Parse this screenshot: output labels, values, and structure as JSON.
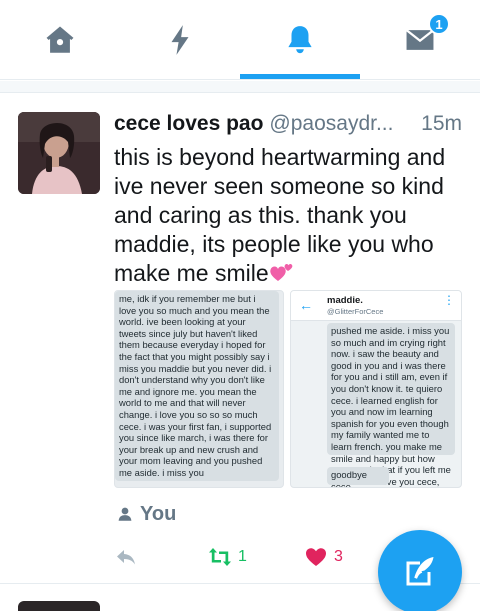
{
  "nav": {
    "tabs": [
      {
        "name": "home",
        "icon": "home-icon"
      },
      {
        "name": "moments",
        "icon": "lightning-icon"
      },
      {
        "name": "notifications",
        "icon": "bell-icon",
        "active": true
      },
      {
        "name": "messages",
        "icon": "envelope-icon"
      }
    ],
    "messages_badge": "1",
    "accent_color": "#1da1f2",
    "inactive_icon_color": "#657786"
  },
  "tweet": {
    "display_name": "cece loves pao",
    "handle": "@paosaydr...",
    "timestamp": "15m",
    "text": "this is beyond heartwarming and ive never seen someone so kind and caring as this. thank you maddie, its people like you who make me smile",
    "emoji": "two-hearts-icon",
    "media": {
      "left_text": "me, idk if you remember me but i love you so much and you mean the world. ive been looking at your tweets since july but haven't liked them because everyday i hoped for the fact that you might possibly say i miss you maddie but you never did. i don't understand why you don't like me and ignore me. you mean the world to me and that will never change. i love you so so so much cece. i was your first fan, i supported you since like march, i was there for your break up and new crush and your mom leaving and you pushed me aside. i miss you",
      "dm_name": "maddie.",
      "dm_handle": "@GlitterForCece",
      "right_text": "pushed me aside. i miss you so much and im crying right now. i saw the beauty and good in you and i was there for you and i still am, even if you don't know it. te quiero cece. i learned english for you and now im learning spanish for you even though my family wanted me to learn french. you make me smile and happy but how can you do that if you left me in the dirt. i love you cece, please never forget that...",
      "right_text_2": "goodbye cece..."
    },
    "context_label": "You",
    "actions": {
      "reply_icon": "reply-icon",
      "retweet_icon": "retweet-icon",
      "retweet_count": "1",
      "like_icon": "heart-icon",
      "like_count": "3"
    },
    "retweet_color": "#17bf63",
    "like_color": "#e0245e"
  },
  "compose": {
    "icon": "compose-icon"
  }
}
